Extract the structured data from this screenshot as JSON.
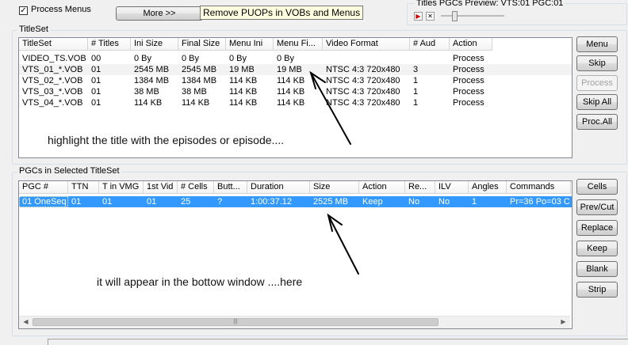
{
  "top": {
    "process_menus_label": "Process Menus",
    "more_button": "More >>",
    "tooltip": "Remove PUOPs in VOBs and Menus",
    "pgc_preview_label": "Titles PGCs Preview: VTS:01 PGC:01"
  },
  "titleset": {
    "label": "TitleSet",
    "columns": [
      "TitleSet",
      "# Titles",
      "Ini Size",
      "Final Size",
      "Menu Ini",
      "Menu Fi...",
      "Video Format",
      "# Aud",
      "Action"
    ],
    "rows": [
      [
        "VIDEO_TS.VOB",
        "00",
        "0 By",
        "0 By",
        "0 By",
        "0 By",
        "",
        "",
        "Process"
      ],
      [
        "VTS_01_*.VOB",
        "01",
        "2545 MB",
        "2545 MB",
        "19 MB",
        "19 MB",
        "NTSC   4:3 720x480",
        "3",
        "Process"
      ],
      [
        "VTS_02_*.VOB",
        "01",
        "1384 MB",
        "1384 MB",
        "114 KB",
        "114 KB",
        "NTSC   4:3 720x480",
        "1",
        "Process"
      ],
      [
        "VTS_03_*.VOB",
        "01",
        "38 MB",
        "38 MB",
        "114 KB",
        "114 KB",
        "NTSC   4:3 720x480",
        "1",
        "Process"
      ],
      [
        "VTS_04_*.VOB",
        "01",
        "114 KB",
        "114 KB",
        "114 KB",
        "114 KB",
        "NTSC   4:3 720x480",
        "1",
        "Process"
      ]
    ],
    "buttons": {
      "menu": "Menu",
      "skip": "Skip",
      "process": "Process",
      "skip_all": "Skip All",
      "proc_all": "Proc.All"
    },
    "annotation": "highlight the title with the episodes or episode...."
  },
  "pgcs": {
    "label": "PGCs in Selected TitleSet",
    "columns": [
      "PGC #",
      "TTN",
      "T in VMG",
      "1st Vid",
      "# Cells",
      "Butt...",
      "Duration",
      "Size",
      "Action",
      "Re...",
      "ILV",
      "Angles",
      "Commands"
    ],
    "rows": [
      [
        "01 OneSeq",
        "01",
        "01",
        "01",
        "25",
        "?",
        "1:00:37.12",
        "2525 MB",
        "Keep",
        "No",
        "No",
        "1",
        "Pr=36 Po=03 C"
      ]
    ],
    "buttons": {
      "cells": "Cells",
      "prev_cut": "Prev/Cut",
      "replace": "Replace",
      "keep": "Keep",
      "blank": "Blank",
      "strip": "Strip"
    },
    "annotation": "it will appear in the bottow window ....here"
  }
}
